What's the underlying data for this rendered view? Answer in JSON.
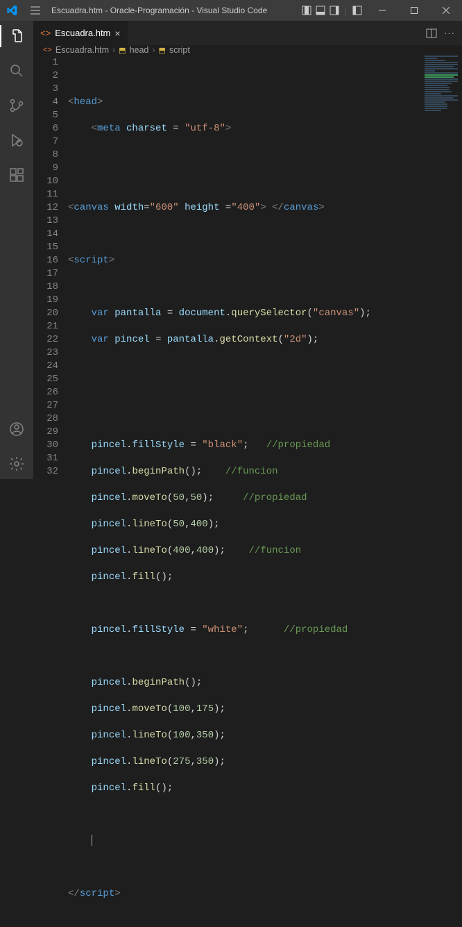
{
  "titlebar": {
    "title": "Escuadra.htm - Oracle-Programación - Visual Studio Code"
  },
  "tab": {
    "filename": "Escuadra.htm"
  },
  "breadcrumb": {
    "file": "Escuadra.htm",
    "p1": "head",
    "p2": "script"
  },
  "gutter": {
    "lines": [
      "1",
      "2",
      "3",
      "4",
      "5",
      "6",
      "7",
      "8",
      "9",
      "10",
      "11",
      "12",
      "13",
      "14",
      "15",
      "16",
      "17",
      "18",
      "19",
      "20",
      "21",
      "22",
      "23",
      "24",
      "25",
      "26",
      "27",
      "28",
      "29",
      "30",
      "31",
      "32"
    ]
  },
  "code": {
    "l2": {
      "tag": "head"
    },
    "l3": {
      "tag": "meta",
      "attr": "charset",
      "val": "\"utf-8\""
    },
    "l6": {
      "tag": "canvas",
      "a1": "width",
      "v1": "\"600\"",
      "a2": "height",
      "v2": "\"400\"",
      "close": "canvas"
    },
    "l8": {
      "tag": "script"
    },
    "l10": {
      "kw": "var",
      "v": "pantalla",
      "o": "document",
      "f": "querySelector",
      "s": "\"canvas\""
    },
    "l11": {
      "kw": "var",
      "v": "pincel",
      "o": "pantalla",
      "f": "getContext",
      "s": "\"2d\""
    },
    "l15": {
      "o": "pincel",
      "p": "fillStyle",
      "s": "\"black\"",
      "c": "//propiedad"
    },
    "l16": {
      "o": "pincel",
      "f": "beginPath",
      "c": "//funcion"
    },
    "l17": {
      "o": "pincel",
      "f": "moveTo",
      "n1": "50",
      "n2": "50",
      "c": "//propiedad"
    },
    "l18": {
      "o": "pincel",
      "f": "lineTo",
      "n1": "50",
      "n2": "400"
    },
    "l19": {
      "o": "pincel",
      "f": "lineTo",
      "n1": "400",
      "n2": "400",
      "c": "//funcion"
    },
    "l20": {
      "o": "pincel",
      "f": "fill"
    },
    "l22": {
      "o": "pincel",
      "p": "fillStyle",
      "s": "\"white\"",
      "c": "//propiedad"
    },
    "l24": {
      "o": "pincel",
      "f": "beginPath"
    },
    "l25": {
      "o": "pincel",
      "f": "moveTo",
      "n1": "100",
      "n2": "175"
    },
    "l26": {
      "o": "pincel",
      "f": "lineTo",
      "n1": "100",
      "n2": "350"
    },
    "l27": {
      "o": "pincel",
      "f": "lineTo",
      "n1": "275",
      "n2": "350"
    },
    "l28": {
      "o": "pincel",
      "f": "fill"
    },
    "l32": {
      "tag": "script"
    }
  }
}
